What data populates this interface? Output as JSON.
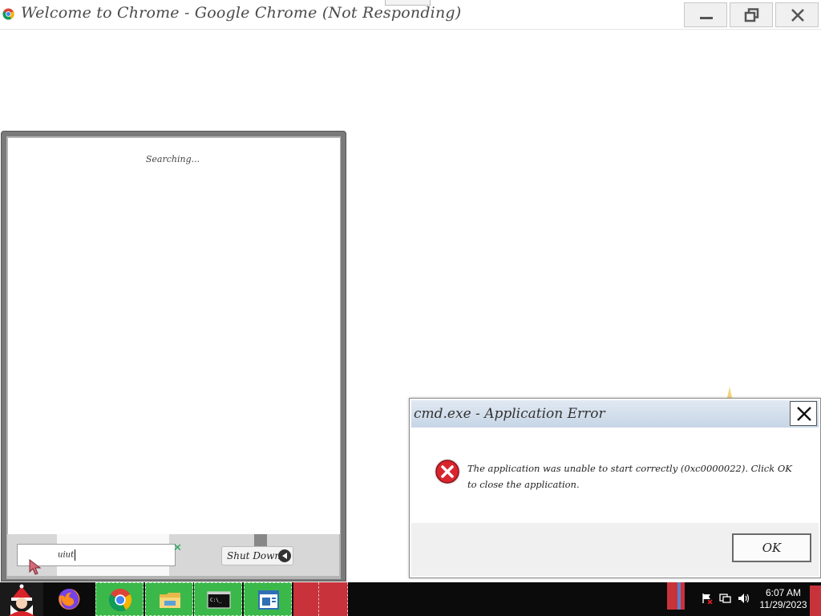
{
  "window": {
    "title": "Welcome to Chrome - Google Chrome (Not Responding)",
    "controls": [
      "minimize",
      "restore",
      "close"
    ]
  },
  "side_panel": {
    "status_text": "Searching...",
    "search_value": "uiut",
    "shutdown_label": "Shut Down"
  },
  "dialog": {
    "title": "cmd.exe - Application Error",
    "message": "The application was unable to start correctly (0xc0000022). Click OK to close the application.",
    "ok_label": "OK",
    "icon": "error-icon"
  },
  "taskbar": {
    "start": "start-icon",
    "apps": [
      {
        "name": "firefox-icon"
      },
      {
        "name": "chrome-icon"
      },
      {
        "name": "file-explorer-icon"
      },
      {
        "name": "command-prompt-icon"
      },
      {
        "name": "notepad-icon"
      }
    ],
    "time": "6:07 AM",
    "date": "11/29/2023",
    "colors": {
      "green": "#3bb84a",
      "red": "#c8323a"
    }
  }
}
